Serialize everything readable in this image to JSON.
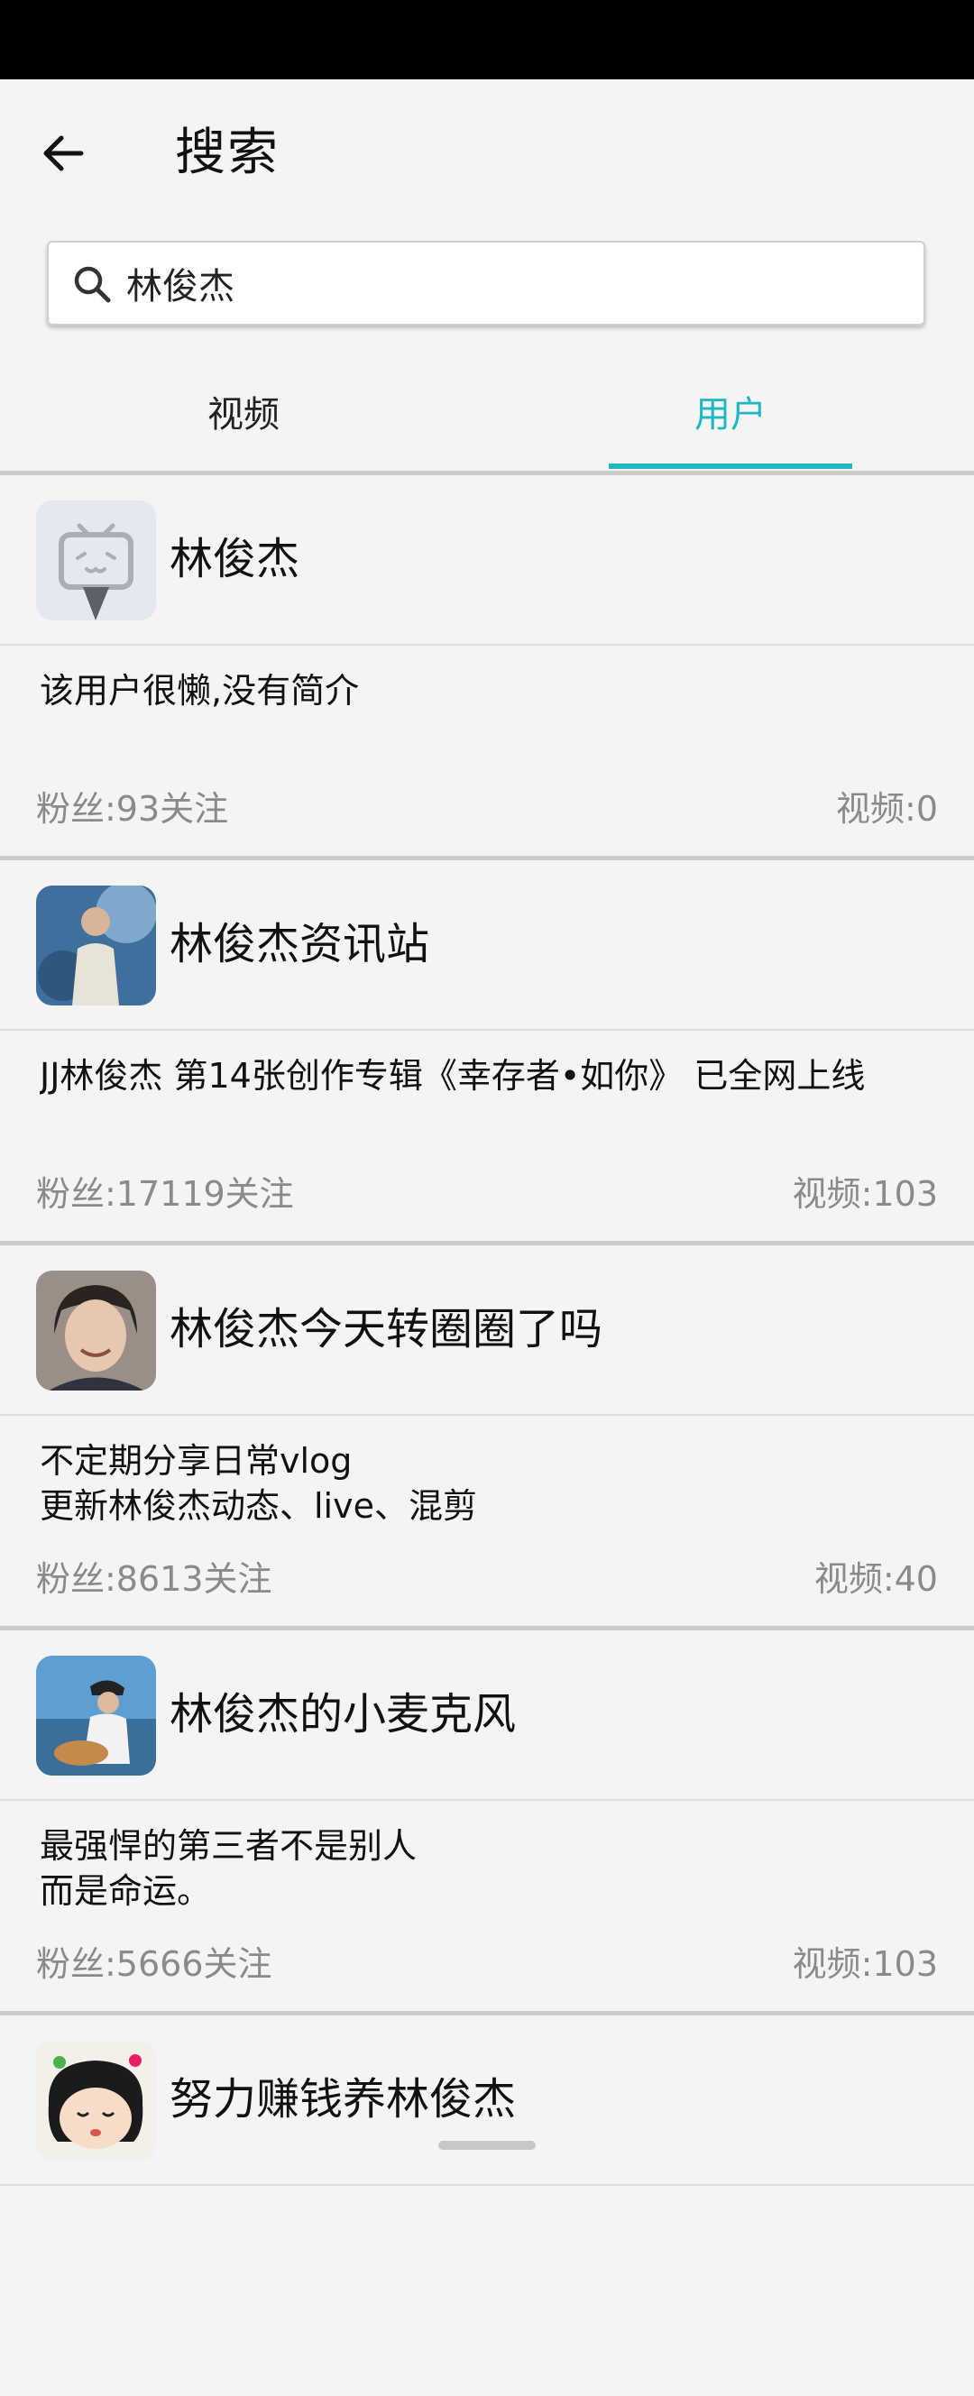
{
  "header": {
    "title": "搜索"
  },
  "search": {
    "query": "林俊杰",
    "placeholder": ""
  },
  "tabs": [
    {
      "label": "视频",
      "active": false
    },
    {
      "label": "用户",
      "active": true
    }
  ],
  "colors": {
    "accent": "#1fb8c2",
    "background": "#f4f4f4",
    "muted_text": "#8a8a8a"
  },
  "users": [
    {
      "name": "林俊杰",
      "bio": "该用户很懒,没有简介",
      "fans": "粉丝:93关注",
      "videos": "视频:0",
      "avatar": "default-tv-avatar"
    },
    {
      "name": "林俊杰资讯站",
      "bio": "JJ林俊杰 第14张创作专辑《幸存者•如你》 已全网上线",
      "fans": "粉丝:17119关注",
      "videos": "视频:103",
      "avatar": "photo-avatar"
    },
    {
      "name": "林俊杰今天转圈圈了吗",
      "bio": "不定期分享日常vlog\n更新林俊杰动态、live、混剪",
      "fans": "粉丝:8613关注",
      "videos": "视频:40",
      "avatar": "photo-avatar"
    },
    {
      "name": "林俊杰的小麦克风",
      "bio": "最强悍的第三者不是别人\n而是命运。",
      "fans": "粉丝:5666关注",
      "videos": "视频:103",
      "avatar": "photo-avatar"
    },
    {
      "name": "努力赚钱养林俊杰",
      "bio": "",
      "fans": "",
      "videos": "",
      "avatar": "cartoon-avatar"
    }
  ]
}
